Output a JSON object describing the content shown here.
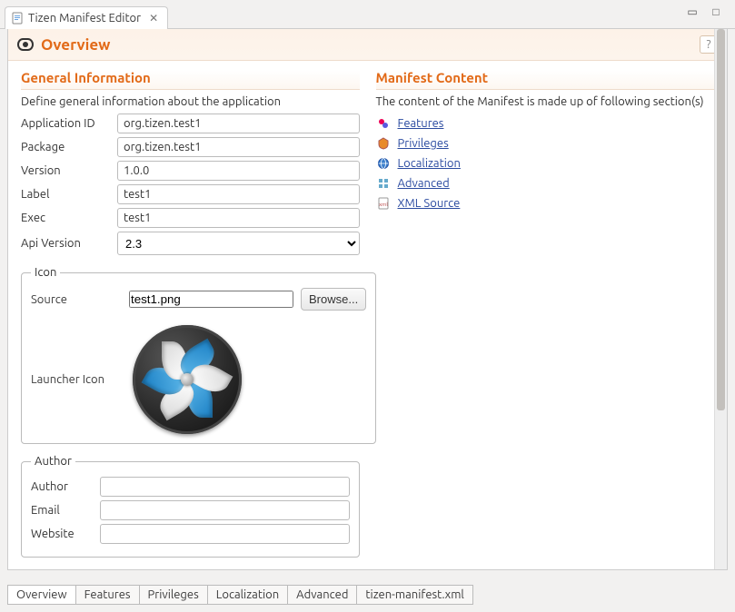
{
  "window": {
    "tab_title": "Tizen Manifest Editor"
  },
  "header": {
    "title": "Overview"
  },
  "general": {
    "section_title": "General Information",
    "desc": "Define general information about the application",
    "labels": {
      "app_id": "Application ID",
      "package": "Package",
      "version": "Version",
      "label": "Label",
      "exec": "Exec",
      "api_version": "Api Version"
    },
    "values": {
      "app_id": "org.tizen.test1",
      "package": "org.tizen.test1",
      "version": "1.0.0",
      "label": "test1",
      "exec": "test1",
      "api_version": "2.3"
    }
  },
  "icon_group": {
    "legend": "Icon",
    "source_label": "Source",
    "source_value": "test1.png",
    "browse_label": "Browse...",
    "launcher_label": "Launcher Icon"
  },
  "author_group": {
    "legend": "Author",
    "labels": {
      "author": "Author",
      "email": "Email",
      "website": "Website"
    },
    "values": {
      "author": "",
      "email": "",
      "website": ""
    }
  },
  "manifest_content": {
    "section_title": "Manifest Content",
    "desc": "The content of the Manifest is made up of following section(s)",
    "links": {
      "features": "Features",
      "privileges": "Privileges",
      "localization": "Localization",
      "advanced": "Advanced",
      "xml_source": "XML Source"
    }
  },
  "bottom_tabs": {
    "overview": "Overview",
    "features": "Features",
    "privileges": "Privileges",
    "localization": "Localization",
    "advanced": "Advanced",
    "xml": "tizen-manifest.xml"
  }
}
